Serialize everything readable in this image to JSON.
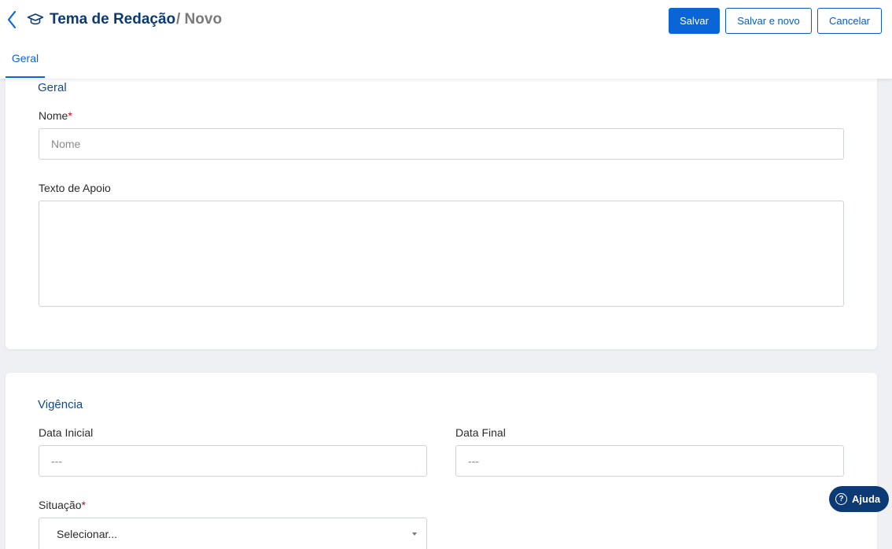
{
  "header": {
    "title": "Tema de Redação",
    "subtitle": "/ Novo"
  },
  "actions": {
    "save": "Salvar",
    "save_new": "Salvar e novo",
    "cancel": "Cancelar"
  },
  "tabs": [
    {
      "label": "Geral",
      "active": true
    }
  ],
  "geral": {
    "section_title": "Geral",
    "nome": {
      "label": "Nome",
      "required_mark": "*",
      "placeholder": "Nome",
      "value": ""
    },
    "texto_apoio": {
      "label": "Texto de Apoio",
      "value": ""
    }
  },
  "vigencia": {
    "section_title": "Vigência",
    "data_inicial": {
      "label": "Data Inicial",
      "placeholder": "---"
    },
    "data_final": {
      "label": "Data Final",
      "placeholder": "---"
    },
    "situacao": {
      "label": "Situação",
      "required_mark": "*",
      "selected": "Selecionar..."
    }
  },
  "help": {
    "label": "Ajuda",
    "icon": "?"
  },
  "icons": {
    "back": "chevron-left-icon",
    "module": "graduation-cap-icon",
    "help": "question-circle-icon",
    "select": "caret-down-icon"
  },
  "colors": {
    "primary": "#0a66d8",
    "title": "#0b3a75",
    "section": "#0b4a96",
    "required": "#d0021b",
    "background": "#eef0f3"
  }
}
